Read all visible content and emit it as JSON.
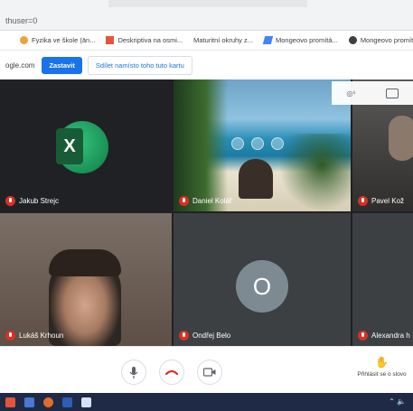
{
  "browser": {
    "url_fragment": "thuser=0",
    "bookmarks": [
      {
        "label": "Fyzika ve škole (ān..."
      },
      {
        "label": "Deskriptiva na osmi..."
      },
      {
        "label": "Maturitní okruhy z..."
      },
      {
        "label": "Mongeovo promítá..."
      },
      {
        "label": "Mongeovo promítá..."
      }
    ]
  },
  "infostrip": {
    "text": "ogle.com",
    "primary_button": "Zastavit",
    "secondary_button": "Sdílet namísto toho tuto kartu"
  },
  "participants": [
    {
      "name": "Jakub Strejc",
      "content": "excel-logo"
    },
    {
      "name": "Daniel Kolář",
      "content": "video"
    },
    {
      "name": "Pavel Kož",
      "content": "video"
    },
    {
      "name": "Lukáš Krhoun",
      "content": "video"
    },
    {
      "name": "Ondřej Belo",
      "content": "avatar",
      "initial": "O"
    },
    {
      "name": "Alexandra h",
      "content": "video"
    }
  ],
  "toolbar": {
    "present_label": "Přihlásit se o slovo"
  },
  "colors": {
    "accent": "#1a73e8",
    "grid_bg": "#202124",
    "mic_off": "#d93025",
    "taskbar": "#1f2b46"
  }
}
